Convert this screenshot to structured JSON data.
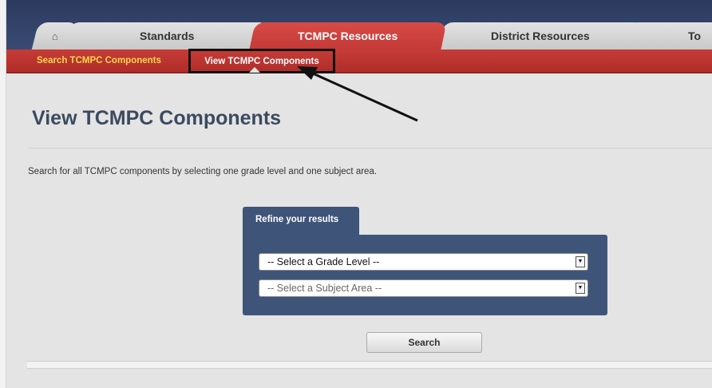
{
  "tabs": {
    "home_icon": "home-icon",
    "standards": "Standards",
    "resources": "TCMPC Resources",
    "district": "District Resources",
    "other": "To"
  },
  "subnav": {
    "search": "Search TCMPC Components",
    "view": "View TCMPC Components"
  },
  "page": {
    "title": "View TCMPC Components",
    "intro": "Search for all TCMPC components by selecting one grade level and one subject area."
  },
  "refine": {
    "label": "Refine your results",
    "grade_select": "-- Select a Grade Level --",
    "subject_select": "-- Select a Subject Area --"
  },
  "actions": {
    "search": "Search"
  },
  "colors": {
    "active_tab": "#c83e3a",
    "subnav_link": "#f6d84a",
    "panel": "#3e5479",
    "title": "#3b4a60"
  }
}
